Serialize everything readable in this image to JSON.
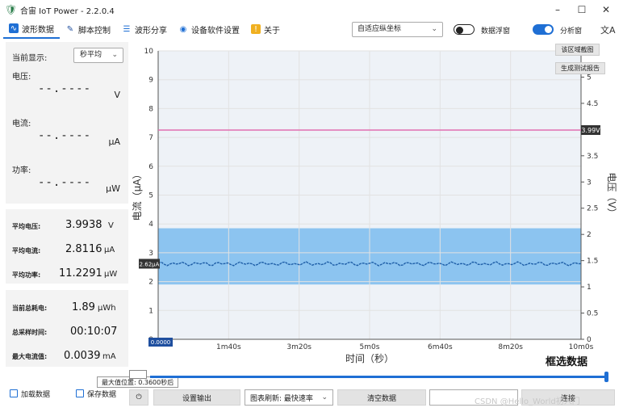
{
  "window": {
    "title": "合宙 IoT Power - 2.2.0.4",
    "minimize": "–",
    "maximize": "☐",
    "close": "✕"
  },
  "toolbar": {
    "tabs": [
      {
        "label": "波形数据",
        "icon": "waveform-icon",
        "active": true
      },
      {
        "label": "脚本控制",
        "icon": "script-icon"
      },
      {
        "label": "波形分享",
        "icon": "share-icon"
      },
      {
        "label": "设备软件设置",
        "icon": "settings-icon"
      },
      {
        "label": "关于",
        "icon": "info-icon"
      }
    ],
    "axis_mode": "自适应纵坐标",
    "float_label": "数据浮窗",
    "analysis_label": "分析窗",
    "translate_glyph": "文A"
  },
  "sidebar": {
    "display_label": "当前显示:",
    "display_value": "秒平均",
    "live": [
      {
        "label": "电压:",
        "value": "--.----",
        "unit": "V"
      },
      {
        "label": "电流:",
        "value": "--.----",
        "unit": "μA"
      },
      {
        "label": "功率:",
        "value": "--.----",
        "unit": "μW"
      }
    ],
    "averages": [
      {
        "label": "平均电压:",
        "value": "3.9938",
        "unit": "V"
      },
      {
        "label": "平均电流:",
        "value": "2.8116",
        "unit": "μA"
      },
      {
        "label": "平均功率:",
        "value": "11.2291",
        "unit": "μW"
      }
    ],
    "totals": [
      {
        "label": "当前总耗电:",
        "value": "1.89",
        "unit": "μWh"
      },
      {
        "label": "总采样时间:",
        "value": "00:10:07",
        "unit": ""
      },
      {
        "label": "最大电流值:",
        "value": "0.0039",
        "unit": "mA"
      }
    ]
  },
  "tooltip": "最大值位置: 0.3600秒后",
  "buttons": {
    "load": "加载数据",
    "save": "保存数据",
    "screenshot": "该区域截图",
    "report": "生成测试报告",
    "settings": "设置输出",
    "refresh": "图表刷新: 最快速率",
    "clear": "清空数据",
    "connect": "连接",
    "slider_small": "",
    "power_glyph": "⏻"
  },
  "watermark": "CSDN @Hello_World初入门",
  "chart_data": {
    "type": "line",
    "xlabel": "时间（秒）",
    "ylabel": "电流（μA）",
    "y2label": "电压（V）",
    "corner_title": "框选数据",
    "x_ticks": [
      "0",
      "1m40s",
      "3m20s",
      "5m0s",
      "6m40s",
      "8m20s",
      "10m0s"
    ],
    "xlim_seconds": [
      0,
      600
    ],
    "ylim": [
      0,
      10
    ],
    "y_ticks": [
      0,
      1,
      2,
      3,
      4,
      5,
      6,
      7,
      8,
      9,
      10
    ],
    "y2lim": [
      0,
      5.5
    ],
    "y2_ticks": [
      0,
      0.5,
      1,
      1.5,
      2,
      2.5,
      3,
      3.5,
      4,
      4.5,
      5,
      5.5
    ],
    "voltage_marker": "3.99V",
    "voltage_value": 3.99,
    "current_marker": "2.62μA",
    "current_value": 2.62,
    "x_start_marker": "0.0000",
    "selection_y": [
      1.9,
      3.85
    ],
    "colors": {
      "voltage": "#e070b0",
      "current": "#1f5fa8",
      "selection": "#8cc4f0",
      "grid": "#e2e2e2"
    }
  }
}
